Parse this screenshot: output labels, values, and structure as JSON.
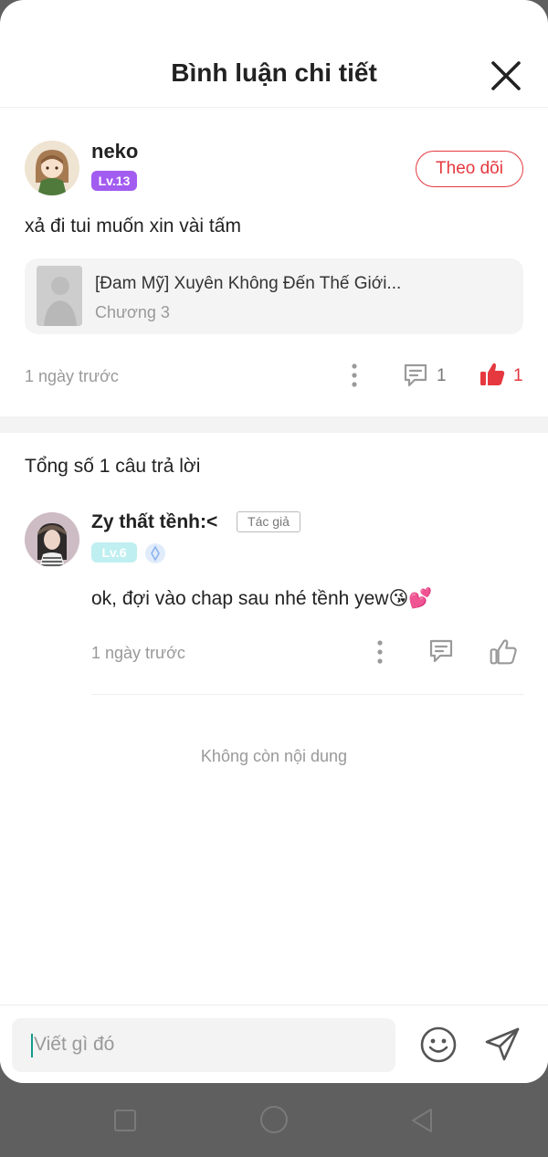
{
  "header": {
    "title": "Bình luận chi tiết"
  },
  "main_comment": {
    "username": "neko",
    "level": "Lv.13",
    "follow_label": "Theo dõi",
    "text": "xả đi tui muốn xin vài tấm",
    "chapter": {
      "title": "[Đam Mỹ] Xuyên Không Đến Thế Giới...",
      "subtitle": "Chương 3"
    },
    "time": "1 ngày trước",
    "reply_count": "1",
    "like_count": "1"
  },
  "replies_section": {
    "title": "Tổng số 1 câu trả lời"
  },
  "reply": {
    "username": "Zy thất tềnh:<",
    "author_tag": "Tác giả",
    "level": "Lv.6",
    "text": "ok, đợi vào chap sau nhé tềnh yew😘💕",
    "time": "1 ngày trước"
  },
  "empty_note": "Không còn nội dung",
  "composer": {
    "placeholder": "Viết gì đó"
  },
  "colors": {
    "accent_red": "#e5393f",
    "level_purple": "#a25cf0",
    "level_teal": "#bfeff0",
    "caret": "#149c8c"
  },
  "icons": [
    "close-icon",
    "more-icon",
    "comment-icon",
    "thumbs-up-icon",
    "emoji-icon",
    "send-icon",
    "nav-square-icon",
    "nav-circle-icon",
    "nav-back-icon"
  ]
}
